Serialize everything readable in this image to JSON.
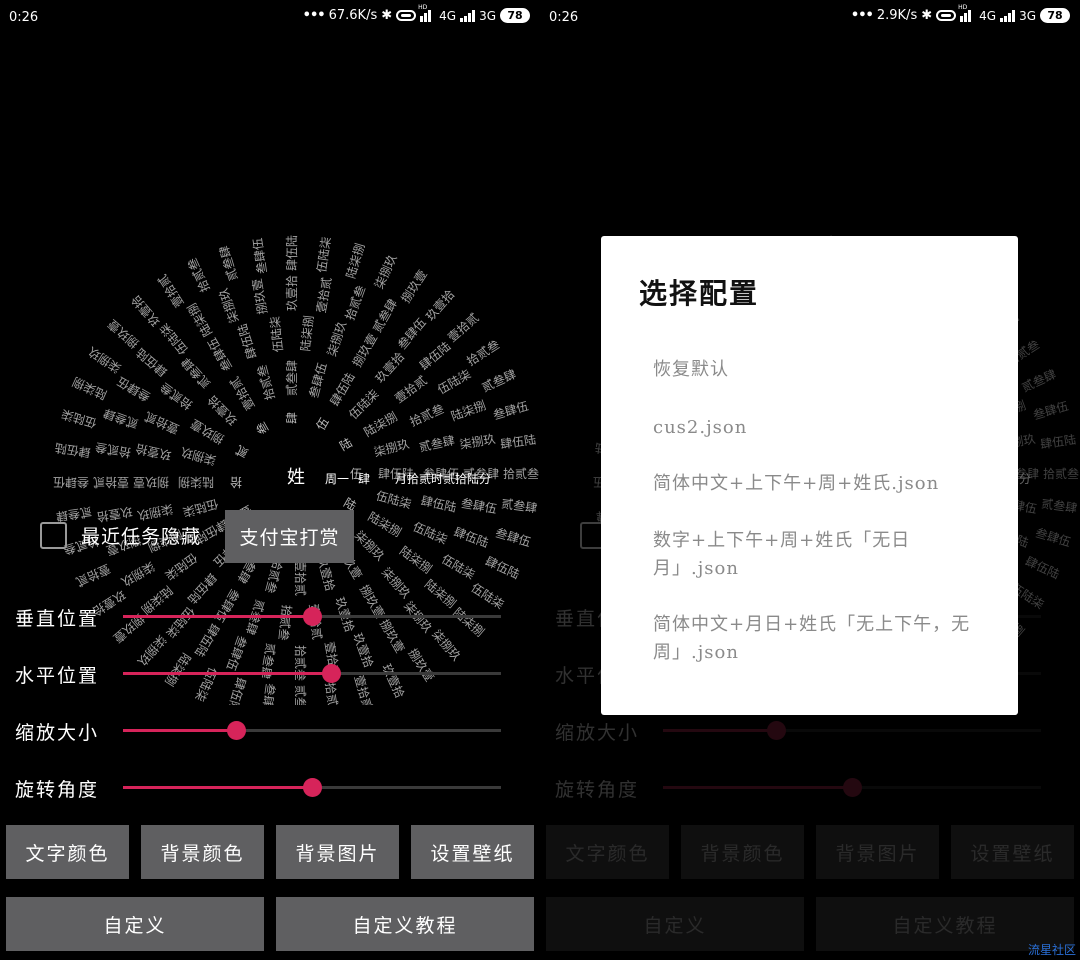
{
  "status_left": {
    "time": "0:26",
    "speed": "67.6K/s",
    "net1": "4G",
    "net2": "3G",
    "battery": "78",
    "hd": "HD"
  },
  "status_right": {
    "time": "0:26",
    "speed": "2.9K/s",
    "net1": "4G",
    "net2": "3G",
    "battery": "78",
    "hd": "HD"
  },
  "clock": {
    "center_char": "姓",
    "minute_value": "月拾贰时贰拾陆分",
    "weekday_value": "周一",
    "hour_value": "肆",
    "text_color": "#ffffff"
  },
  "controls": {
    "hide_recent_label": "最近任务隐藏",
    "hide_recent_checked": false,
    "alipay_label": "支付宝打赏",
    "sliders": [
      {
        "label": "垂直位置",
        "value": 0.5
      },
      {
        "label": "水平位置",
        "value": 0.55
      },
      {
        "label": "缩放大小",
        "value": 0.3
      },
      {
        "label": "旋转角度",
        "value": 0.5
      }
    ],
    "buttons_row1": [
      "文字颜色",
      "背景颜色",
      "背景图片",
      "设置壁纸"
    ],
    "buttons_row2": [
      "自定义",
      "自定义教程"
    ]
  },
  "dialog": {
    "title": "选择配置",
    "items": [
      "恢复默认",
      "cus2.json",
      "简体中文+上下午+周+姓氏.json",
      "数字+上下午+周+姓氏「无日月」.json",
      "简体中文+月日+姓氏「无上下午，无周」.json"
    ]
  },
  "watermark": "流星社区",
  "colors": {
    "accent": "#d6245a",
    "button_bg": "#5f5f61",
    "track": "#3a3a3a"
  }
}
